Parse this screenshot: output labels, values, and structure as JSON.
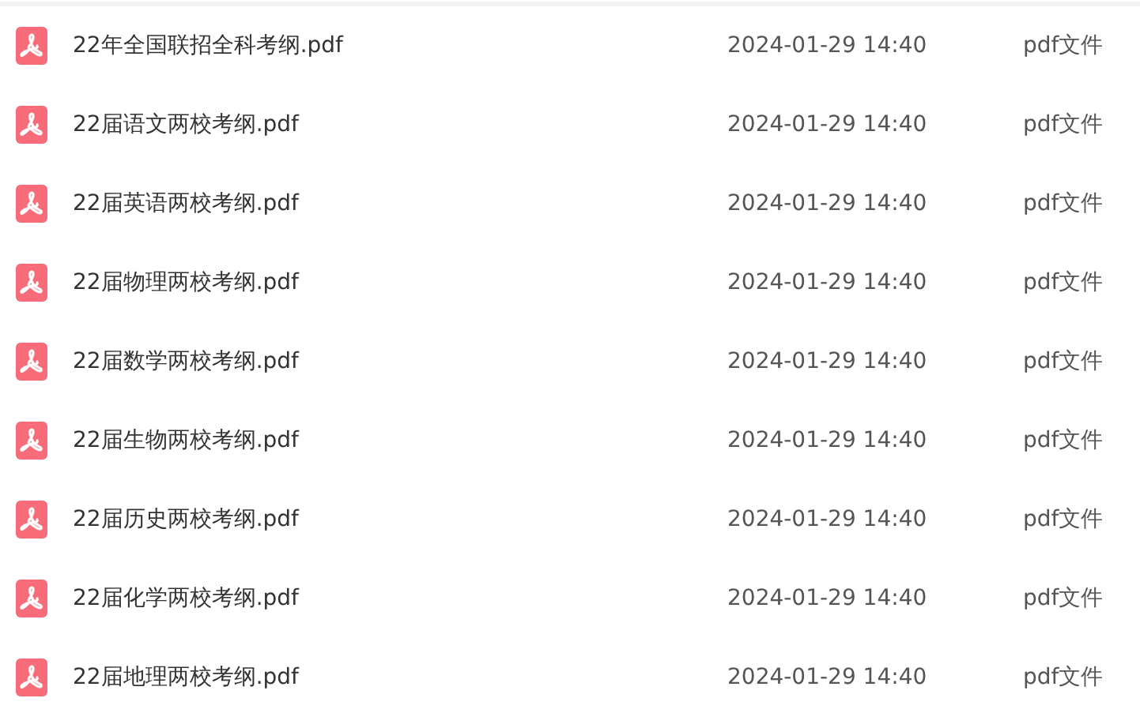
{
  "files": [
    {
      "name": "22年全国联招全科考纲.pdf",
      "modified": "2024-01-29 14:40",
      "type": "pdf文件"
    },
    {
      "name": "22届语文两校考纲.pdf",
      "modified": "2024-01-29 14:40",
      "type": "pdf文件"
    },
    {
      "name": "22届英语两校考纲.pdf",
      "modified": "2024-01-29 14:40",
      "type": "pdf文件"
    },
    {
      "name": "22届物理两校考纲.pdf",
      "modified": "2024-01-29 14:40",
      "type": "pdf文件"
    },
    {
      "name": "22届数学两校考纲.pdf",
      "modified": "2024-01-29 14:40",
      "type": "pdf文件"
    },
    {
      "name": "22届生物两校考纲.pdf",
      "modified": "2024-01-29 14:40",
      "type": "pdf文件"
    },
    {
      "name": "22届历史两校考纲.pdf",
      "modified": "2024-01-29 14:40",
      "type": "pdf文件"
    },
    {
      "name": "22届化学两校考纲.pdf",
      "modified": "2024-01-29 14:40",
      "type": "pdf文件"
    },
    {
      "name": "22届地理两校考纲.pdf",
      "modified": "2024-01-29 14:40",
      "type": "pdf文件"
    }
  ]
}
